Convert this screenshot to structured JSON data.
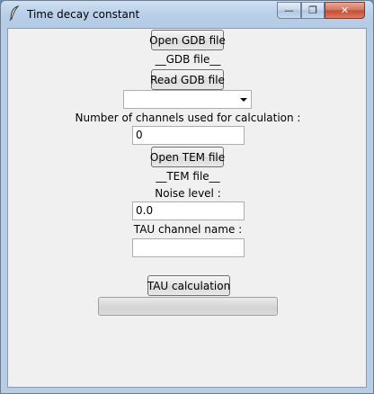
{
  "window": {
    "title": "Time decay constant",
    "min_glyph": "—",
    "max_glyph": "❐",
    "close_glyph": "✕"
  },
  "gdb": {
    "open_label": "Open GDB file",
    "file_label": "__GDB file__",
    "read_label": "Read GDB file",
    "select_value": ""
  },
  "channels": {
    "label": "Number of channels used for calculation :",
    "value": "0"
  },
  "tem": {
    "open_label": "Open TEM file",
    "file_label": "__TEM file__"
  },
  "noise": {
    "label": "Noise level :",
    "value": "0.0"
  },
  "tau_channel": {
    "label": "TAU channel name :",
    "value": ""
  },
  "tau_button": {
    "label": "TAU calculation"
  },
  "progress": {
    "value": 0
  },
  "colors": {
    "background": "#f0f0f0",
    "titlebar": "#b9cfe7",
    "close": "#c54a32"
  },
  "icons": [
    "feather-icon",
    "minimize-icon",
    "maximize-icon",
    "close-icon",
    "dropdown-arrow-icon"
  ]
}
